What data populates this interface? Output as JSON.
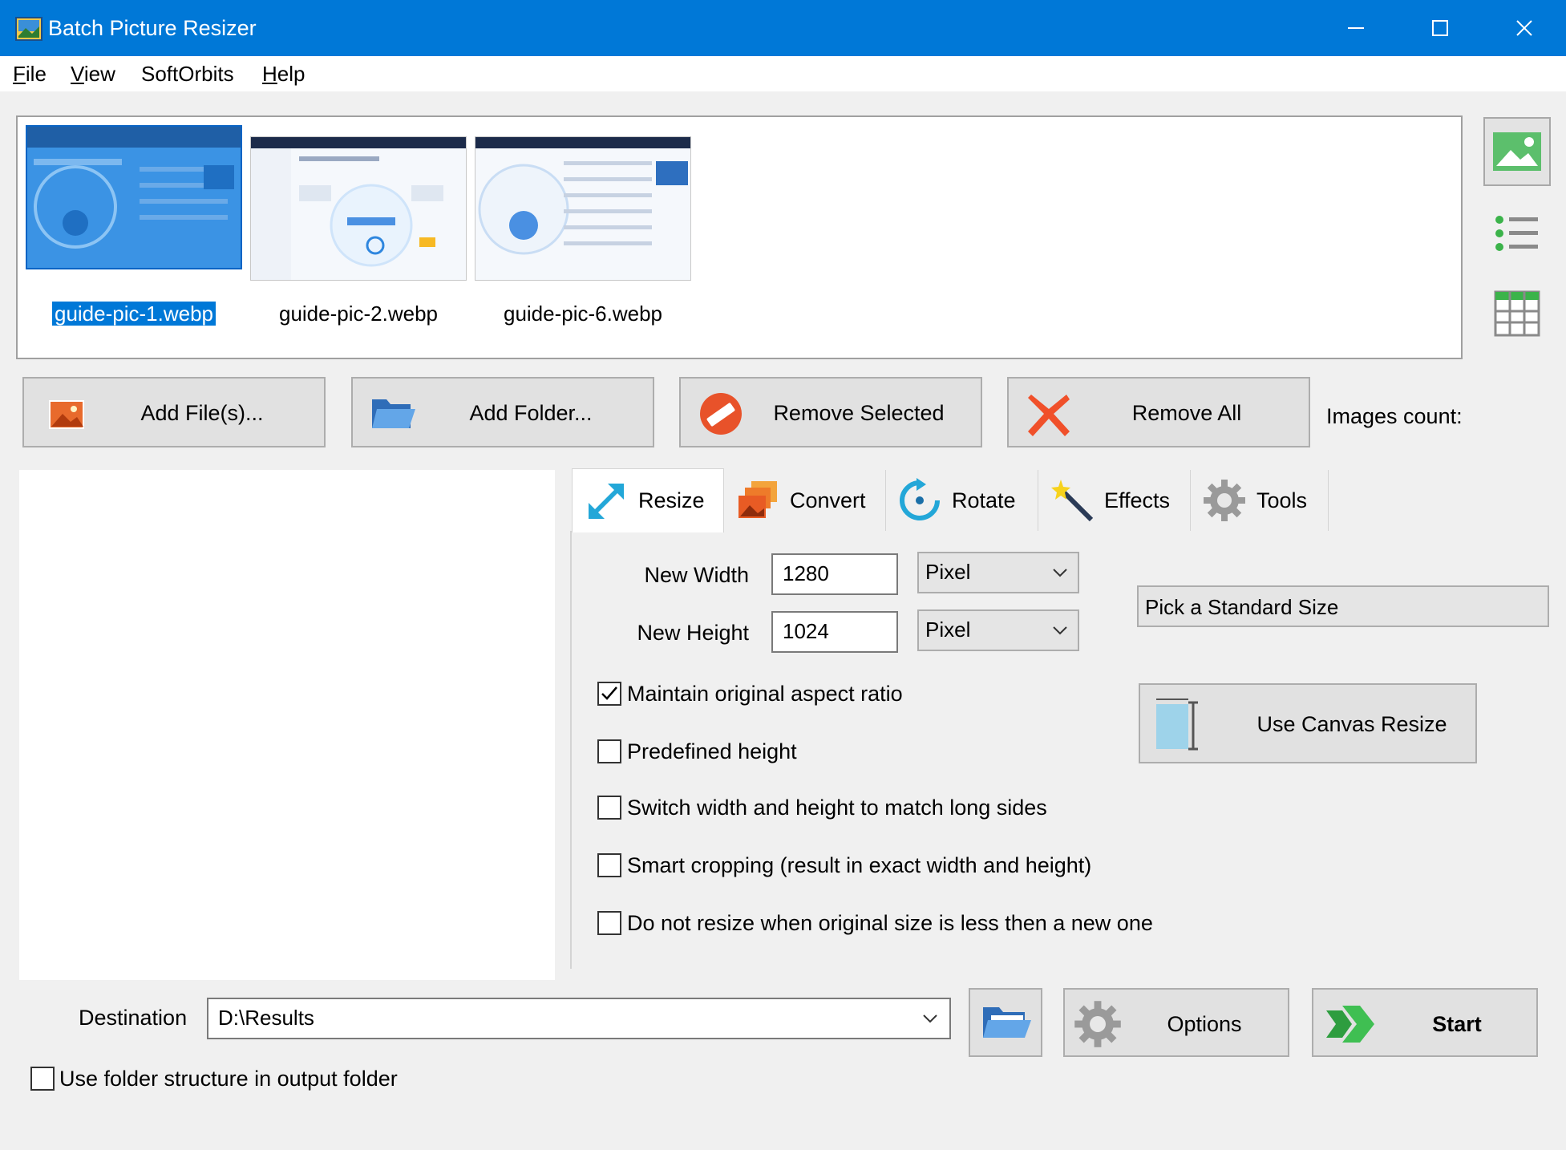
{
  "window": {
    "title": "Batch Picture Resizer",
    "title_bar_color": "#0078d7",
    "controls": [
      "minimize-icon",
      "maximize-icon",
      "close-icon"
    ]
  },
  "menu": [
    {
      "label": "File",
      "mnemonic": "F",
      "rest": "ile"
    },
    {
      "label": "View",
      "mnemonic": "V",
      "rest": "iew"
    },
    {
      "label": "SoftOrbits",
      "mnemonic": "",
      "rest": "SoftOrbits"
    },
    {
      "label": "Help",
      "mnemonic": "H",
      "rest": "elp"
    }
  ],
  "thumbnails": [
    {
      "name": "guide-pic-1.webp",
      "selected": true
    },
    {
      "name": "guide-pic-2.webp",
      "selected": false
    },
    {
      "name": "guide-pic-6.webp",
      "selected": false
    }
  ],
  "view_modes": [
    "thumbnail-view-icon",
    "list-view-icon",
    "grid-view-icon"
  ],
  "actions": {
    "add_files": "Add File(s)...",
    "add_folder": "Add Folder...",
    "remove_selected": "Remove Selected",
    "remove_all": "Remove All",
    "images_count_label": "Images count:"
  },
  "tabs": [
    {
      "label": "Resize",
      "icon": "resize-arrows-icon",
      "active": true
    },
    {
      "label": "Convert",
      "icon": "convert-images-icon",
      "active": false
    },
    {
      "label": "Rotate",
      "icon": "rotate-icon",
      "active": false
    },
    {
      "label": "Effects",
      "icon": "magic-wand-icon",
      "active": false
    },
    {
      "label": "Tools",
      "icon": "gear-icon",
      "active": false
    }
  ],
  "resize": {
    "new_width_label": "New Width",
    "new_width_value": "1280",
    "width_unit": "Pixel",
    "new_height_label": "New Height",
    "new_height_value": "1024",
    "height_unit": "Pixel",
    "standard_size": "Pick a Standard Size",
    "canvas_resize": "Use Canvas Resize",
    "options": [
      {
        "label": "Maintain original aspect ratio",
        "checked": true
      },
      {
        "label": "Predefined height",
        "checked": false
      },
      {
        "label": "Switch width and height to match long sides",
        "checked": false
      },
      {
        "label": "Smart cropping (result in exact width and height)",
        "checked": false
      },
      {
        "label": "Do not resize when original size is less then a new one",
        "checked": false
      }
    ]
  },
  "bottom": {
    "destination_label": "Destination",
    "destination_value": "D:\\Results",
    "use_folder_structure": "Use folder structure in output folder",
    "use_folder_structure_checked": false,
    "options_label": "Options",
    "start_label": "Start"
  }
}
